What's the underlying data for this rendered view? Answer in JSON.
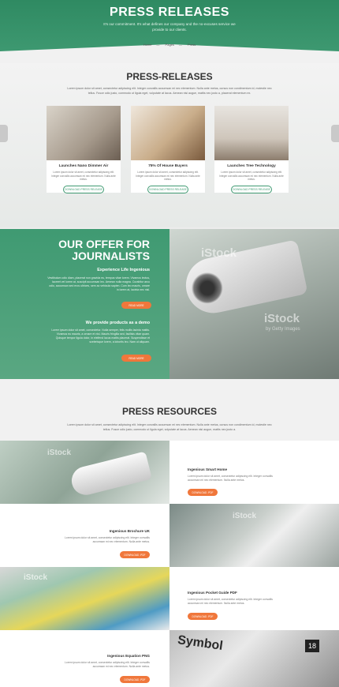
{
  "hero": {
    "title": "PRESS RELEASES",
    "subtitle": "It's our commitment. It's what defines our company and the no-excuses service we provide to our clients.",
    "breadcrumbs": [
      "Home",
      "Pages",
      "Press"
    ]
  },
  "press_releases": {
    "title": "PRESS-RELEASES",
    "intro": "Lorem ipsum dolor sit amet, consectetur adipiscing elit. Integer convallis accumsan mi nec elementum. Nulla ante metus, cursus non condimentum id, molestie nec tellus. Fusce odio justo, commodo ut ligula eget, vulputate at lacus. Aenean nisi augue, mattis nec justo a, placerat elementum ex.",
    "cards": [
      {
        "title": "Launches Nano Dimmer Air",
        "text": "Lorem ipsum dolor sit amet, consectetur adipiscing elit. Integer convallis accumsan mi nec elementum. Nulla ante metus.",
        "button": "DOWNLOAD PRESS RELEASE"
      },
      {
        "title": "75% Of House Buyers",
        "text": "Lorem ipsum dolor sit amet, consectetur adipiscing elit. Integer convallis accumsan mi nec elementum. Nulla ante metus.",
        "button": "DOWNLOAD PRESS RELEASE"
      },
      {
        "title": "Launches Tree Technology",
        "text": "Lorem ipsum dolor sit amet, consectetur adipiscing elit. Integer convallis accumsan mi nec elementum. Nulla ante metus.",
        "button": "DOWNLOAD PRESS RELEASE"
      }
    ]
  },
  "offer": {
    "title_line1": "OUR OFFER FOR",
    "title_line2": "JOURNALISTS",
    "block1_title": "Experience Life Ingenious",
    "block1_text": "Vestibulum odio diam, placerat non gravida eu, tempus vitae lorem. Vivamus lectus, laoreet vel lorem at, suscipit accumsan leo. Aenean nulla magna. Curabitur arcu odio, accumsan sed eros ultrices, sem ac vehicula sapien. Cum leo mauris, ornare in lorem at, lacinia nec nisl.",
    "block1_button": "READ MORE",
    "block2_title": "We provide products as a demo",
    "block2_text": "Lorem ipsum dolor sit amet, consectetur. Nulla semper, felis mollis lacinia mattis. Vivamus eu mauris, a ornare et nisi. Mauris fringilla sed, facilisis vitae quam. Quisque tempor ligula dolor, in eleifend lacus mattis placerat. Suspendisse et scelerisque lorem, a lobortis leo. Nam ut aliquam.",
    "block2_button": "READ MORE",
    "watermarks": [
      "iStock",
      "by Getty Images"
    ]
  },
  "resources": {
    "title": "PRESS RESOURCES",
    "intro": "Lorem ipsum dolor sit amet, consectetur adipiscing elit. Integer convallis accumsan mi nec elementum. Nulla ante metus, cursus non condimentum id, molestie nec tellus. Fusce odio justo, commodo ut ligula eget, vulputate at lacus. Aenean nisi augue, mattis nec justo a.",
    "items": [
      {
        "title": "Ingenious Smart Home",
        "text": "Lorem ipsum dolor sit amet, consectetur adipiscing elit. Integer convallis accumsan mi nec elementum. Nulla ante metus.",
        "button": "DOWNLOAD .PDF"
      },
      {
        "title": "Ingenious Brochure UK",
        "text": "Lorem ipsum dolor sit amet, consectetur adipiscing elit. Integer convallis accumsan mi nec elementum. Nulla ante metus.",
        "button": "DOWNLOAD .PDF"
      },
      {
        "title": "Ingenious Pocket Guide PDF",
        "text": "Lorem ipsum dolor sit amet, consectetur adipiscing elit. Integer convallis accumsan mi nec elementum. Nulla ante metus.",
        "button": "DOWNLOAD .PDF"
      },
      {
        "title": "Ingenious Equation PNG",
        "text": "Lorem ipsum dolor sit amet, consectetur adipiscing elit. Integer convallis accumsan mi nec elementum. Nulla ante metus.",
        "button": "DOWNLOAD .PDF"
      }
    ],
    "watermark": "iStock",
    "book_label": "Symbol",
    "page_badge": "18"
  },
  "colors": {
    "green": "#3f9a72",
    "orange": "#f0773b",
    "gray": "#ececec"
  }
}
